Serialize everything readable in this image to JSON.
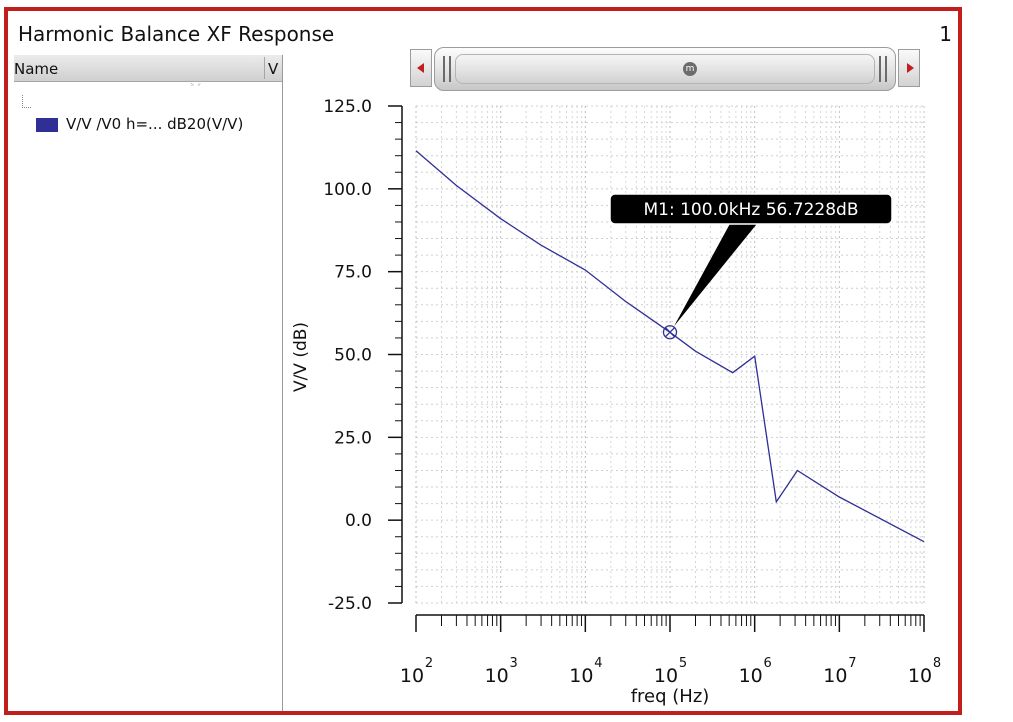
{
  "window": {
    "title": "Harmonic Balance XF Response",
    "page_number": "1",
    "frame_color": "#c21e1e"
  },
  "legend": {
    "header_name": "Name",
    "header_value": "V",
    "entries": [
      {
        "label": "V/V /V0 h=... dB20(V/V)",
        "color": "#2f2f96"
      }
    ]
  },
  "scrollbar": {
    "left_arrow_icon": "scroll-left-icon",
    "right_arrow_icon": "scroll-right-icon",
    "center_icon_text": "m"
  },
  "marker": {
    "label": "M1: 100.0kHz 56.7228dB",
    "x": 100000,
    "y": 56.7228
  },
  "chart_data": {
    "type": "line",
    "title": "",
    "xlabel": "freq (Hz)",
    "ylabel": "V/V (dB)",
    "xscale": "log",
    "xlim": [
      100,
      100000000
    ],
    "ylim": [
      -25,
      125
    ],
    "y_ticks": [
      "125.0",
      "100.0",
      "75.0",
      "50.0",
      "25.0",
      "0.0",
      "-25.0"
    ],
    "x_ticks": [
      {
        "base": "10",
        "exp": "2"
      },
      {
        "base": "10",
        "exp": "3"
      },
      {
        "base": "10",
        "exp": "4"
      },
      {
        "base": "10",
        "exp": "5"
      },
      {
        "base": "10",
        "exp": "6"
      },
      {
        "base": "10",
        "exp": "7"
      },
      {
        "base": "10",
        "exp": "8"
      }
    ],
    "grid": true,
    "series": [
      {
        "color": "#2f2f96",
        "points": [
          [
            100,
            111.5
          ],
          [
            300,
            101
          ],
          [
            1000,
            91
          ],
          [
            3000,
            83
          ],
          [
            10000,
            75.5
          ],
          [
            30000,
            66
          ],
          [
            100000,
            56.7
          ],
          [
            200000,
            51
          ],
          [
            550000,
            44.5
          ],
          [
            1000000,
            49.5
          ],
          [
            1800000,
            5.5
          ],
          [
            3200000,
            15
          ],
          [
            10000000,
            7
          ],
          [
            100000000,
            -6.5
          ]
        ]
      }
    ]
  }
}
